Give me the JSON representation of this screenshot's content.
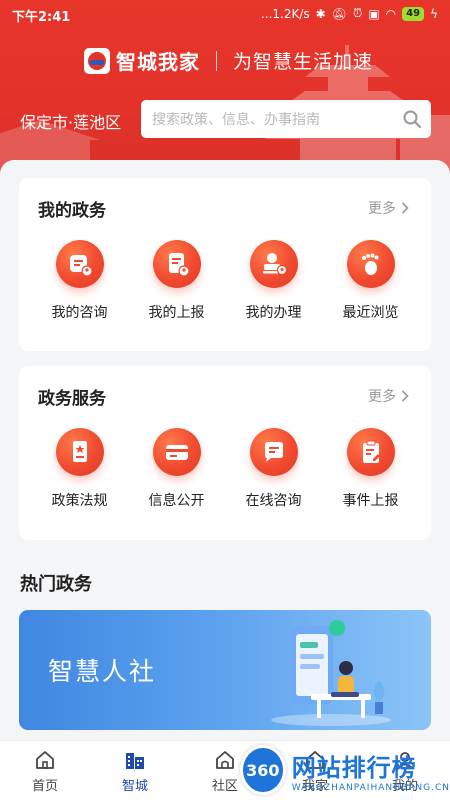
{
  "status_bar": {
    "time": "下午2:41",
    "network_speed": "...1.2K/s",
    "battery": "49"
  },
  "header": {
    "app_name": "智城我家",
    "slogan": "为智慧生活加速",
    "city": "保定市·莲池区",
    "search_placeholder": "搜索政策、信息、办事指南"
  },
  "my_affairs": {
    "title": "我的政务",
    "more": "更多",
    "items": [
      {
        "label": "我的咨询",
        "icon": "consult-person-icon"
      },
      {
        "label": "我的上报",
        "icon": "report-person-icon"
      },
      {
        "label": "我的办理",
        "icon": "handle-stamp-icon"
      },
      {
        "label": "最近浏览",
        "icon": "footprint-icon"
      }
    ]
  },
  "gov_services": {
    "title": "政务服务",
    "more": "更多",
    "items": [
      {
        "label": "政策法规",
        "icon": "policy-doc-icon"
      },
      {
        "label": "信息公开",
        "icon": "info-card-icon"
      },
      {
        "label": "在线咨询",
        "icon": "chat-bubble-icon"
      },
      {
        "label": "事件上报",
        "icon": "clipboard-edit-icon"
      }
    ]
  },
  "hot": {
    "title": "热门政务",
    "banner_text": "智慧人社"
  },
  "tabbar": {
    "tabs": [
      {
        "label": "首页",
        "icon": "home-icon"
      },
      {
        "label": "智城",
        "icon": "city-building-icon",
        "active": true
      },
      {
        "label": "社区",
        "icon": "community-icon"
      },
      {
        "label": "我家",
        "icon": "my-home-icon"
      },
      {
        "label": "我的",
        "icon": "profile-icon"
      }
    ]
  },
  "watermark": {
    "logo_text": "360",
    "name": "网站排行榜",
    "url": "WANGZHANPAIHANGBANG.CN"
  },
  "colors": {
    "brand_red": "#e2322a",
    "accent_blue": "#1f4aa8",
    "background": "#f4f5f7"
  }
}
